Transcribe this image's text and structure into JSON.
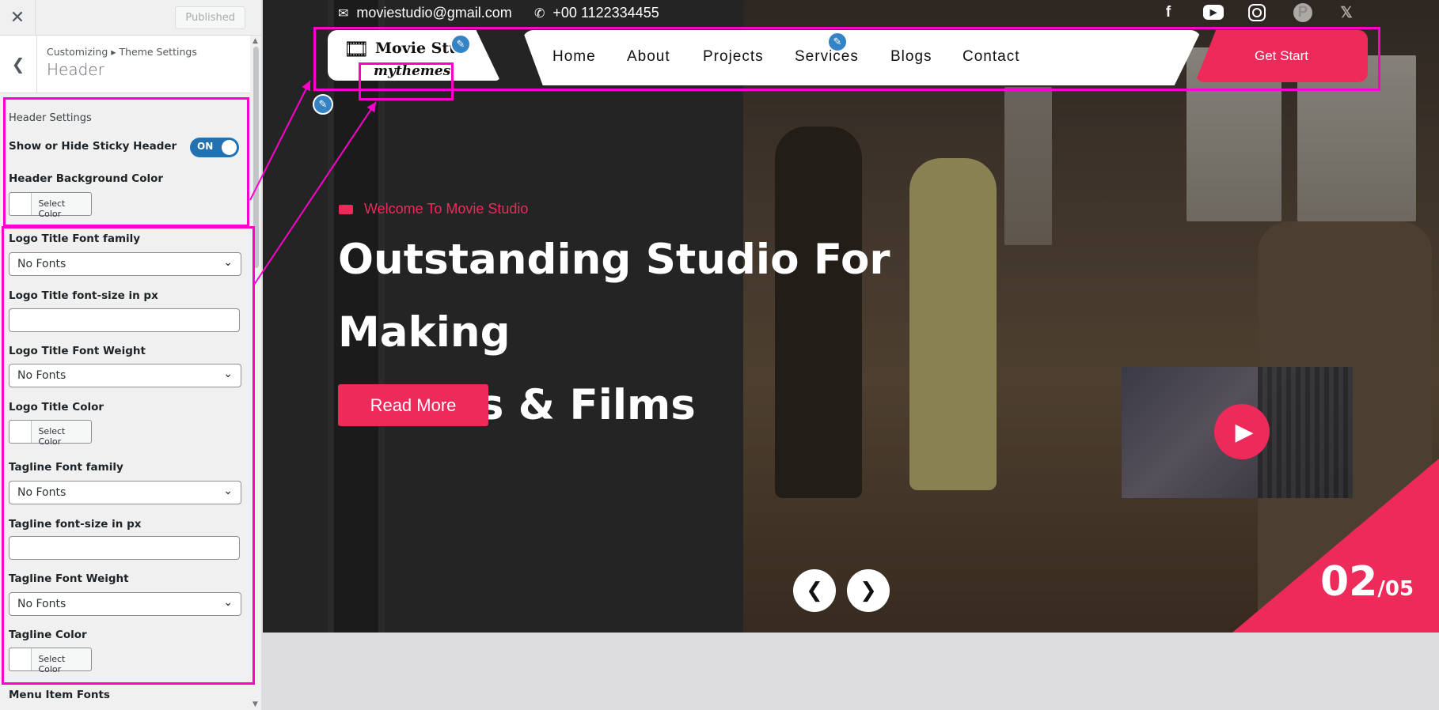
{
  "customizer": {
    "close_icon": "close-icon",
    "publish_label": "Published",
    "breadcrumb": "Customizing ▸ Theme Settings",
    "section_title": "Header",
    "header_settings_heading": "Header Settings",
    "sticky_label": "Show or Hide Sticky Header",
    "sticky_toggle": "ON",
    "header_bg_label": "Header Background Color",
    "select_color": "Select Color",
    "logo_font_family_label": "Logo Title Font family",
    "logo_font_family_value": "No Fonts",
    "logo_font_size_label": "Logo Title font-size in px",
    "logo_font_size_value": "",
    "logo_font_weight_label": "Logo Title Font Weight",
    "logo_font_weight_value": "No Fonts",
    "logo_color_label": "Logo Title Color",
    "tagline_font_family_label": "Tagline Font family",
    "tagline_font_family_value": "No Fonts",
    "tagline_font_size_label": "Tagline font-size in px",
    "tagline_font_size_value": "",
    "tagline_font_weight_label": "Tagline Font Weight",
    "tagline_font_weight_value": "No Fonts",
    "tagline_color_label": "Tagline Color",
    "menu_fonts_label": "Menu Item Fonts"
  },
  "site": {
    "email": "moviestudio@gmail.com",
    "phone": "+00 1122334455",
    "logo_title": "Movie Stu",
    "tagline": "mythemes",
    "nav": [
      "Home",
      "About",
      "Projects",
      "Services",
      "Blogs",
      "Contact"
    ],
    "cta": "Get Start",
    "social_facebook": "f",
    "social_youtube": "▶",
    "social_x": "𝕏",
    "social_pinterest": "P"
  },
  "hero": {
    "welcome": "Welcome To Movie Studio",
    "title_line1": "Outstanding Studio For Making",
    "title_line2": "Movies & Films",
    "read_more": "Read More",
    "slide_current": "02",
    "slide_total": "/05"
  },
  "colors": {
    "accent": "#ee2a5b",
    "highlight": "#ff00cc",
    "wp_blue": "#2271b1"
  }
}
